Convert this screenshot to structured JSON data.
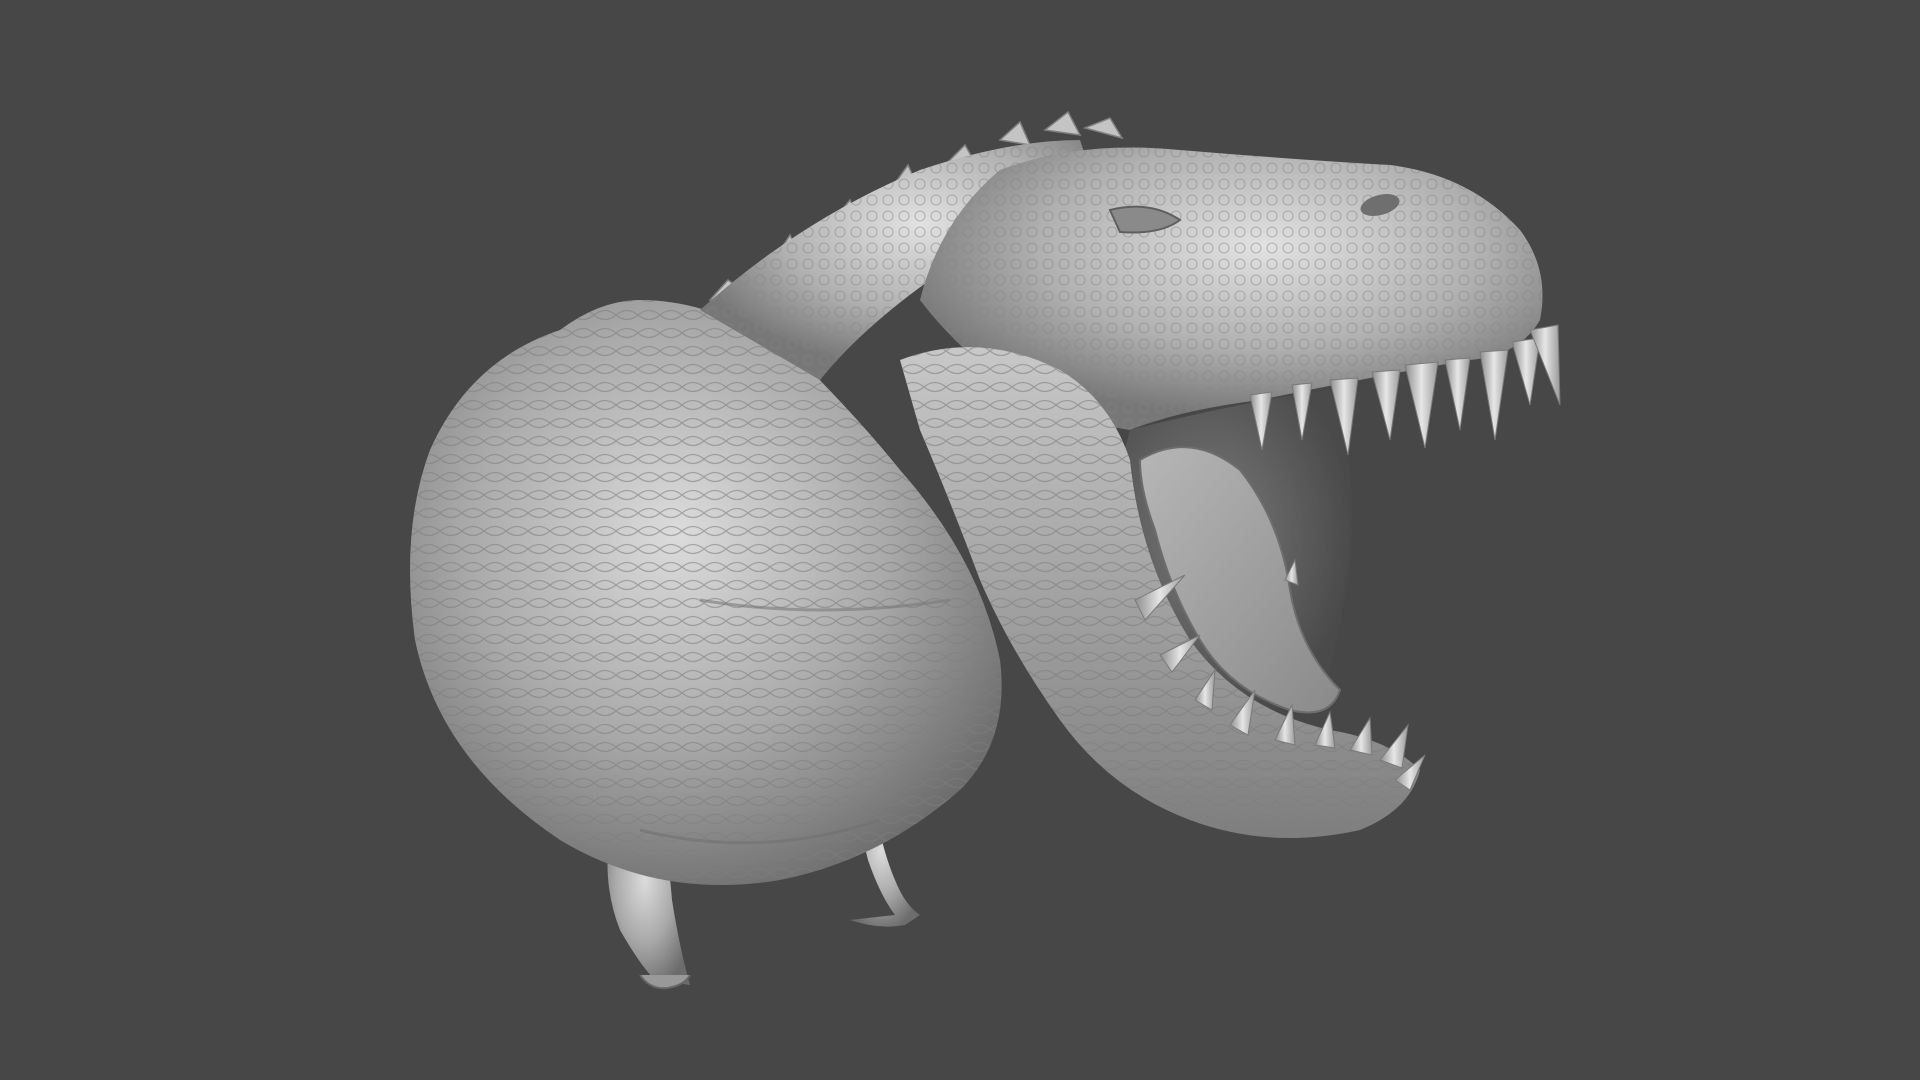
{
  "viewport": {
    "background_color": "#474747",
    "model_color": "#b8b8b8",
    "model_shadow_color": "#6a6a6a",
    "model_highlight_color": "#e4e4e4",
    "tooth_color": "#c9c9c9",
    "mouth_interior_color": "#5a5a5a",
    "subject": "sculpted-dinosaur-bust"
  }
}
